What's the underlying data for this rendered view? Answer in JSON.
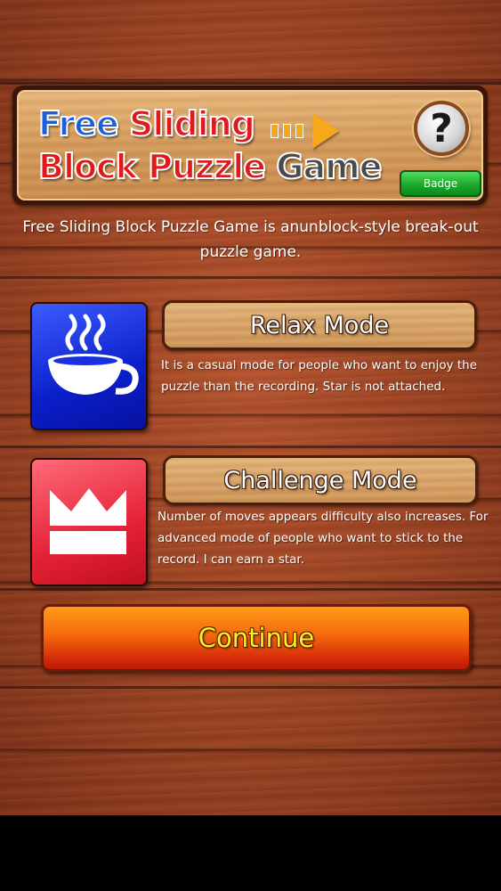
{
  "header": {
    "logo_line1_a": "Free",
    "logo_line1_b": "Sliding",
    "logo_line2_a": "Block Puzzle",
    "logo_line2_b": "Game",
    "help_glyph": "?",
    "badge_label": "Badge"
  },
  "description": "Free Sliding Block Puzzle Game is anunblock-style break-out puzzle game.",
  "modes": {
    "relax": {
      "title": "Relax Mode",
      "text": "It is a casual mode for people who want to enjoy the puzzle than the recording. Star is not attached.",
      "icon": "coffee-cup-icon",
      "color": "#1a2fe0"
    },
    "challenge": {
      "title": "Challenge Mode",
      "text": "Number of moves appears difficulty also increases. For advanced mode of people who want to stick to the record. I can earn a star.",
      "icon": "crown-icon",
      "color": "#e52236"
    }
  },
  "continue_label": "Continue",
  "colors": {
    "wood": "#9a4222",
    "continue_text": "#ffee22",
    "badge_green": "#1aa52a"
  }
}
